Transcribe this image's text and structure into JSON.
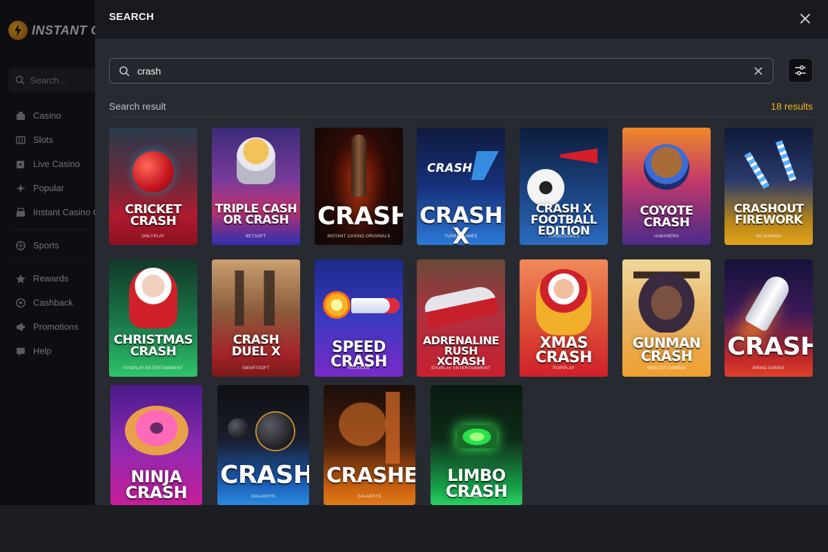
{
  "app": {
    "logo_text": "INSTANT C",
    "sidebar_search_placeholder": "Search...",
    "menu": [
      {
        "label": "Casino",
        "icon": "casino-icon"
      },
      {
        "label": "Slots",
        "icon": "slots-icon"
      },
      {
        "label": "Live Casino",
        "icon": "live-casino-icon"
      },
      {
        "label": "Popular",
        "icon": "popular-icon"
      },
      {
        "label": "Instant Casino O",
        "icon": "instant-originals-icon"
      },
      {
        "label": "Sports",
        "icon": "sports-icon"
      },
      {
        "label": "Rewards",
        "icon": "star-icon"
      },
      {
        "label": "Cashback",
        "icon": "cashback-icon"
      },
      {
        "label": "Promotions",
        "icon": "promotions-icon"
      },
      {
        "label": "Help",
        "icon": "help-icon"
      }
    ]
  },
  "modal": {
    "title": "SEARCH",
    "search_value": "crash",
    "result_label": "Search result",
    "result_count": "18 results"
  },
  "colors": {
    "accent": "#f2b51e",
    "modal_bg": "#272a31",
    "header_bg": "#181a1f"
  },
  "games": [
    {
      "title": "CRICKET CRASH",
      "provider": "ONLYPLAY"
    },
    {
      "title": "TRIPLE CASH OR CRASH",
      "provider": "BETSOFT"
    },
    {
      "title": "CRASH",
      "provider": "INSTANT CASINO ORIGINALS"
    },
    {
      "title": "CRASH X",
      "provider": "TURBO GAMES"
    },
    {
      "title": "CRASH X FOOTBALL EDITION",
      "provider": "TURBOGAMES"
    },
    {
      "title": "COYOTE CRASH",
      "provider": "HABANERO"
    },
    {
      "title": "CRASHOUT FIREWORK",
      "provider": "SG GAMING"
    },
    {
      "title": "CHRISTMAS CRASH",
      "provider": "EVOPLAY ENTERTAINMENT"
    },
    {
      "title": "CRASH DUEL X",
      "provider": "SMARTSOFT"
    },
    {
      "title": "SPEED CRASH",
      "provider": "HACKSAW"
    },
    {
      "title": "ADRENALINE RUSH XCRASH",
      "provider": "EVOPLAY ENTERTAINMENT"
    },
    {
      "title": "XMAS CRASH",
      "provider": "POPIPLAY"
    },
    {
      "title": "GUNMAN CRASH",
      "provider": "MASCOT GAMING"
    },
    {
      "title": "CRASH",
      "provider": "BRINO GAMES"
    },
    {
      "title": "NINJA CRASH",
      "provider": "GALAKSYS"
    },
    {
      "title": "CRASH",
      "provider": "GALAKSYS"
    },
    {
      "title": "CRASHER",
      "provider": "GALAKSYS"
    },
    {
      "title": "LIMBO CRASH",
      "provider": "GALAKSYS"
    }
  ]
}
